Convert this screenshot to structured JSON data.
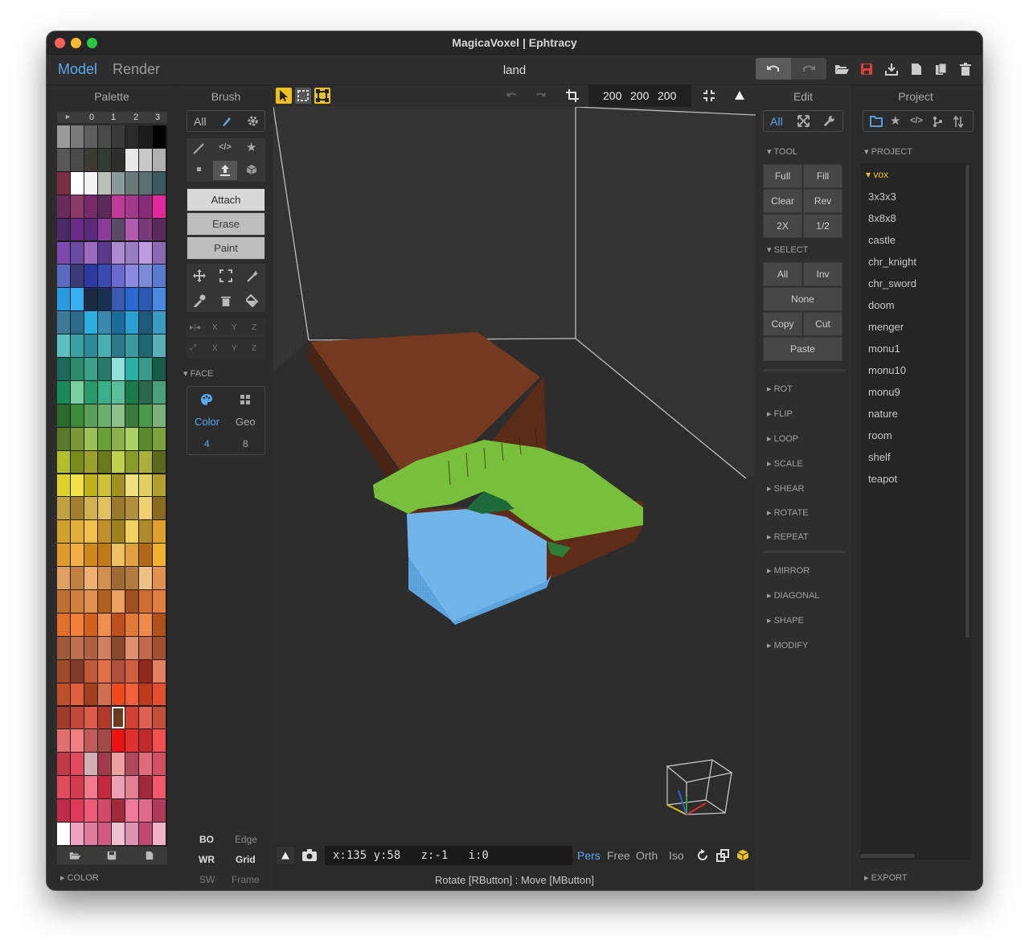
{
  "window": {
    "title": "MagicaVoxel | Ephtracy"
  },
  "topbar": {
    "tab_model": "Model",
    "tab_render": "Render",
    "filename": "land",
    "icons": [
      "undo-icon",
      "redo-icon",
      "open-folder-icon",
      "save-icon",
      "export-icon",
      "new-file-icon",
      "copy-file-icon",
      "delete-icon"
    ]
  },
  "palette": {
    "title": "Palette",
    "columns": [
      "0",
      "1",
      "2",
      "3"
    ],
    "footer": "COLOR",
    "selected_color": "#6b3a1f"
  },
  "brush": {
    "title": "Brush",
    "filter_label": "All",
    "modes": [
      "Attach",
      "Erase",
      "Paint"
    ],
    "axis_labels": [
      "X",
      "Y",
      "Z"
    ],
    "face_section": "FACE",
    "face": {
      "color_label": "Color",
      "color_value": "4",
      "geo_label": "Geo",
      "geo_value": "8"
    },
    "bottom": {
      "bo": "BO",
      "edge": "Edge",
      "wr": "WR",
      "grid": "Grid",
      "sw": "SW",
      "frame": "Frame"
    }
  },
  "viewport": {
    "size_x": "200",
    "size_y": "200",
    "size_z": "200",
    "coords": "x:135 y:58   z:-1   i:0",
    "view_modes": [
      "Pers",
      "Free",
      "Orth",
      "Iso"
    ],
    "active_view": "Pers",
    "hint": "Rotate [RButton] : Move [MButton]"
  },
  "edit": {
    "title": "Edit",
    "filter_label": "All",
    "tool_section": "TOOL",
    "tool_buttons": [
      "Full",
      "Fill",
      "Clear",
      "Rev",
      "2X",
      "1/2"
    ],
    "select_section": "SELECT",
    "select_buttons": [
      "All",
      "Inv"
    ],
    "select_none": "None",
    "select_copy": "Copy",
    "select_cut": "Cut",
    "select_paste": "Paste",
    "sections_a": [
      "ROT",
      "FLIP",
      "LOOP",
      "SCALE",
      "SHEAR",
      "ROTATE",
      "REPEAT"
    ],
    "sections_b": [
      "MIRROR",
      "DIAGONAL",
      "SHAPE",
      "MODIFY"
    ]
  },
  "project": {
    "title": "Project",
    "section": "PROJECT",
    "folder": "vox",
    "items": [
      "3x3x3",
      "8x8x8",
      "castle",
      "chr_knight",
      "chr_sword",
      "doom",
      "menger",
      "monu1",
      "monu10",
      "monu9",
      "nature",
      "room",
      "shelf",
      "teapot"
    ],
    "footer": "EXPORT"
  },
  "colors": {
    "accent": "#5aa9f0",
    "folder": "#f0c020",
    "active_tool": "#f0c020",
    "terrain_dirt": "#7a3a22",
    "terrain_grass": "#7cc040",
    "terrain_water": "#6fb6ec"
  }
}
